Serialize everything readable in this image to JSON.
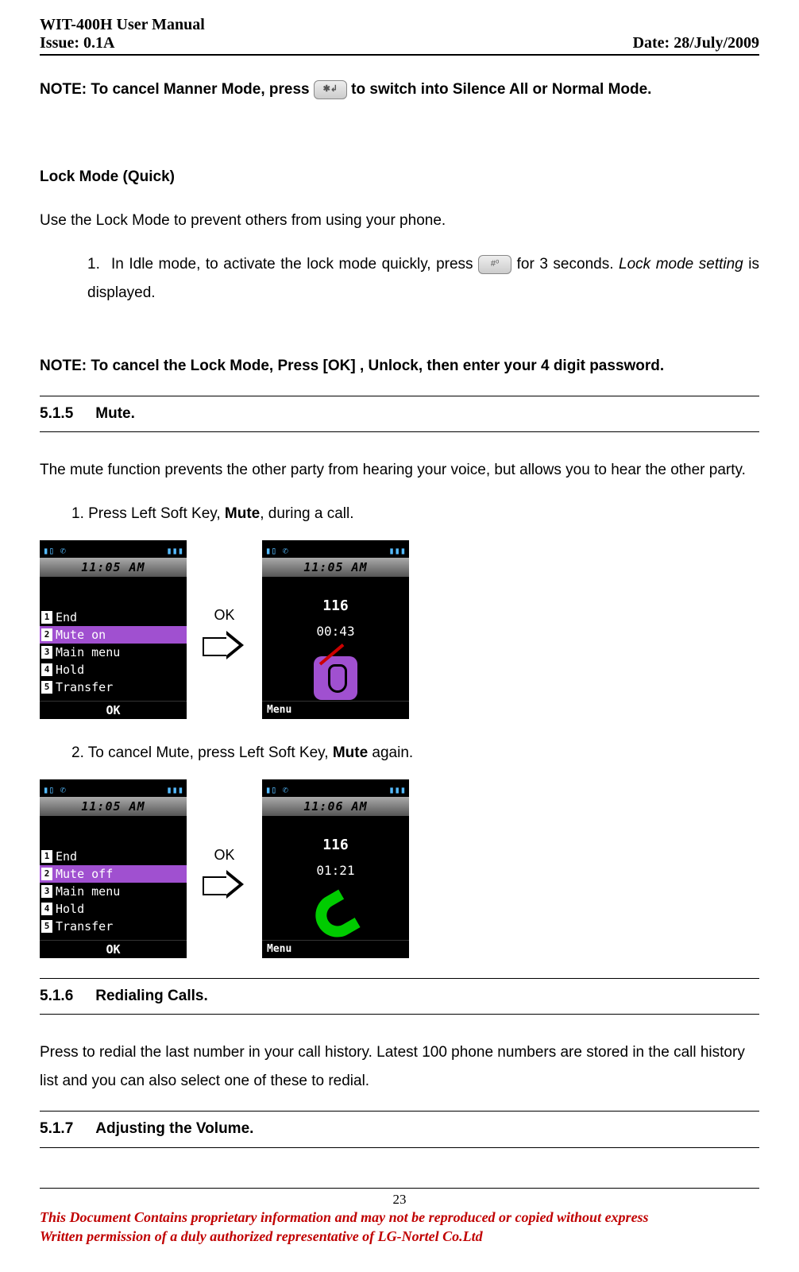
{
  "header": {
    "title": "WIT-400H User Manual",
    "issue": "Issue: 0.1A",
    "date": "Date: 28/July/2009"
  },
  "note_manner": {
    "prefix": "NOTE: To cancel Manner Mode, press ",
    "suffix": " to switch into Silence All or Normal Mode.",
    "key_glyph": "✱↲"
  },
  "lock_mode": {
    "heading": "Lock Mode (Quick)",
    "intro": "Use the Lock Mode to prevent others from using your phone.",
    "step_prefix": "In Idle mode, to activate the lock mode quickly, press ",
    "step_mid": " for 3 seconds. ",
    "step_em": "Lock mode setting",
    "step_suffix": " is displayed.",
    "key_glyph": "#⁰"
  },
  "note_lock": "NOTE: To cancel the Lock Mode, Press [OK] , Unlock, then enter your 4 digit password.",
  "sec_mute": {
    "num": "5.1.5",
    "title": "Mute."
  },
  "mute_intro": "The mute function prevents the other party from hearing your voice, but allows you to hear the other party.",
  "mute_step1_a": "1. Press Left Soft Key, ",
  "mute_step1_b": "Mute",
  "mute_step1_c": ", during a call.",
  "mute_step2_a": "2. To cancel Mute, press Left Soft Key, ",
  "mute_step2_b": "Mute",
  "mute_step2_c": " again.",
  "arrow_label": "OK",
  "screen1_left": {
    "time": "11:05 AM",
    "items": [
      "End",
      "Mute on",
      "Main menu",
      "Hold",
      "Transfer"
    ],
    "selected_index": 1,
    "softkey": "OK"
  },
  "screen1_right": {
    "time": "11:05 AM",
    "number": "116",
    "duration": "00:43",
    "softkey": "Menu"
  },
  "screen2_left": {
    "time": "11:05 AM",
    "items": [
      "End",
      "Mute off",
      "Main menu",
      "Hold",
      "Transfer"
    ],
    "selected_index": 1,
    "softkey": "OK"
  },
  "screen2_right": {
    "time": "11:06 AM",
    "number": "116",
    "duration": "01:21",
    "softkey": "Menu"
  },
  "sec_redial": {
    "num": "5.1.6",
    "title": "Redialing Calls."
  },
  "redial_text": "Press to redial the last number in your call history. Latest 100 phone numbers are stored in the call history list and you can also select one of these to redial.",
  "sec_volume": {
    "num": "5.1.7",
    "title": "Adjusting the Volume."
  },
  "footer": {
    "page": "23",
    "line1": "This Document Contains proprietary information and may not be reproduced or copied without express",
    "line2": "Written permission of a duly authorized representative of LG-Nortel Co.Ltd"
  }
}
